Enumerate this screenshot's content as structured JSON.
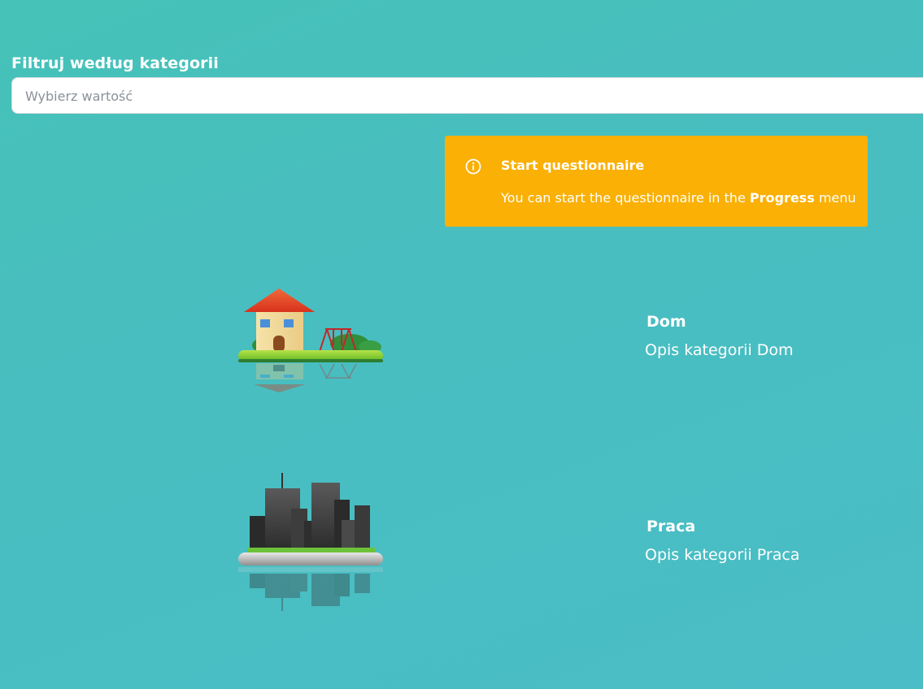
{
  "filter": {
    "label": "Filtruj według kategorii",
    "placeholder": "Wybierz wartość"
  },
  "notice": {
    "icon": "info-icon",
    "title": "Start questionnaire",
    "text_before": "You can start the questionnaire in the ",
    "text_bold": "Progress",
    "text_after": " menu",
    "color": "#fab004"
  },
  "categories": [
    {
      "title": "Dom",
      "description": "Opis kategorii Dom",
      "icon": "house-island-icon"
    },
    {
      "title": "Praca",
      "description": "Opis kategorii Praca",
      "icon": "city-island-icon"
    }
  ],
  "colors": {
    "background": "#48bfbf",
    "text": "#ffffff"
  }
}
